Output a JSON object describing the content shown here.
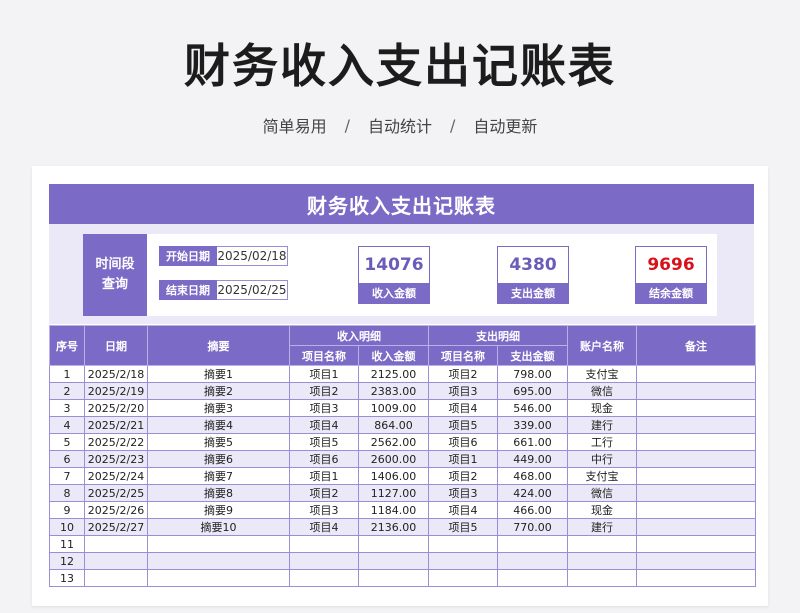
{
  "page": {
    "title": "财务收入支出记账表",
    "subtitle_items": [
      "简单易用",
      "自动统计",
      "自动更新"
    ],
    "separator": "/"
  },
  "sheet": {
    "title": "财务收入支出记账表",
    "time_label_line1": "时间段",
    "time_label_line2": "查询",
    "start_label": "开始日期",
    "start_value": "2025/02/18",
    "end_label": "结束日期",
    "end_value": "2025/02/25",
    "stats": [
      {
        "value": "14076",
        "label": "收入金额"
      },
      {
        "value": "4380",
        "label": "支出金额"
      },
      {
        "value": "9696",
        "label": "结余金额"
      }
    ],
    "colors": {
      "accent": "#7b6bc6",
      "band": "#ebe9f7",
      "negative": "#d7121b"
    }
  },
  "table": {
    "headers": {
      "seq": "序号",
      "date": "日期",
      "summary": "摘要",
      "income_group": "收入明细",
      "expense_group": "支出明细",
      "account": "账户名称",
      "remark": "备注",
      "item_name": "项目名称",
      "income_amount": "收入金额",
      "expense_amount": "支出金额"
    },
    "rows": [
      [
        "1",
        "2025/2/18",
        "摘要1",
        "项目1",
        "2125.00",
        "项目2",
        "798.00",
        "支付宝",
        ""
      ],
      [
        "2",
        "2025/2/19",
        "摘要2",
        "项目2",
        "2383.00",
        "项目3",
        "695.00",
        "微信",
        ""
      ],
      [
        "3",
        "2025/2/20",
        "摘要3",
        "项目3",
        "1009.00",
        "项目4",
        "546.00",
        "现金",
        ""
      ],
      [
        "4",
        "2025/2/21",
        "摘要4",
        "项目4",
        "864.00",
        "项目5",
        "339.00",
        "建行",
        ""
      ],
      [
        "5",
        "2025/2/22",
        "摘要5",
        "项目5",
        "2562.00",
        "项目6",
        "661.00",
        "工行",
        ""
      ],
      [
        "6",
        "2025/2/23",
        "摘要6",
        "项目6",
        "2600.00",
        "项目1",
        "449.00",
        "中行",
        ""
      ],
      [
        "7",
        "2025/2/24",
        "摘要7",
        "项目1",
        "1406.00",
        "项目2",
        "468.00",
        "支付宝",
        ""
      ],
      [
        "8",
        "2025/2/25",
        "摘要8",
        "项目2",
        "1127.00",
        "项目3",
        "424.00",
        "微信",
        ""
      ],
      [
        "9",
        "2025/2/26",
        "摘要9",
        "项目3",
        "1184.00",
        "项目4",
        "466.00",
        "现金",
        ""
      ],
      [
        "10",
        "2025/2/27",
        "摘要10",
        "项目4",
        "2136.00",
        "项目5",
        "770.00",
        "建行",
        ""
      ],
      [
        "11",
        "",
        "",
        "",
        "",
        "",
        "",
        "",
        ""
      ],
      [
        "12",
        "",
        "",
        "",
        "",
        "",
        "",
        "",
        ""
      ],
      [
        "13",
        "",
        "",
        "",
        "",
        "",
        "",
        "",
        ""
      ]
    ]
  }
}
